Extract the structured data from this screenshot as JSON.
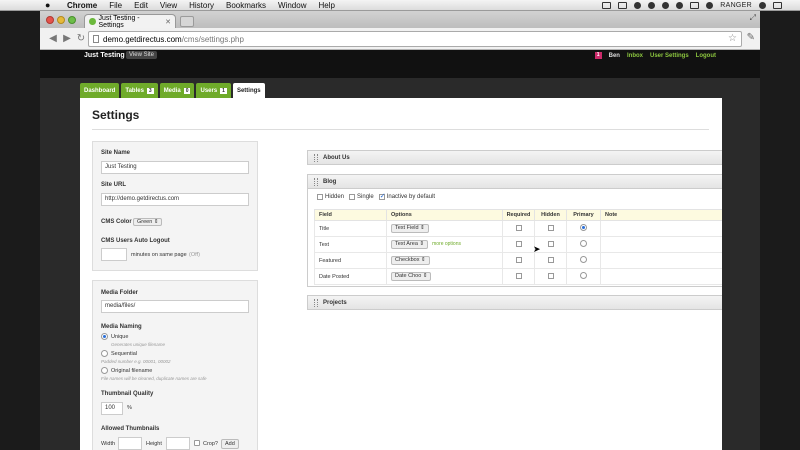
{
  "menubar": {
    "apple": "",
    "items": [
      "Chrome",
      "File",
      "Edit",
      "View",
      "History",
      "Bookmarks",
      "Window",
      "Help"
    ],
    "user": "RANGER"
  },
  "browser": {
    "tab_title": "Just Testing - Settings",
    "url_host": "demo.getdirectus.com",
    "url_path": "/cms/settings.php"
  },
  "header": {
    "site_title": "Just Testing",
    "view_site": "View Site",
    "badge": "1",
    "user_name": "Ben",
    "links": [
      "Inbox",
      "User Settings",
      "Logout"
    ]
  },
  "nav": {
    "dashboard": "Dashboard",
    "tables": "Tables",
    "tables_count": "3",
    "media": "Media",
    "media_count": "0",
    "users": "Users",
    "users_count": "1",
    "settings": "Settings"
  },
  "page": {
    "title": "Settings"
  },
  "general": {
    "site_name_label": "Site Name",
    "site_name_value": "Just Testing",
    "site_url_label": "Site URL",
    "site_url_value": "http://demo.getdirectus.com",
    "cms_color_label": "CMS Color",
    "cms_color_value": "Green",
    "logout_label": "CMS Users Auto Logout",
    "logout_suffix": "minutes on same page",
    "logout_off": "(Off)"
  },
  "media": {
    "folder_label": "Media Folder",
    "folder_value": "media/files/",
    "naming_label": "Media Naming",
    "opt_unique": "Unique",
    "opt_unique_hint": "Generates unique filename",
    "opt_sequential": "Sequential",
    "opt_sequential_hint": "Padded number e.g. 00001, 00002",
    "opt_original": "Original filename",
    "opt_original_hint": "File names will be cleaned, duplicate names are safe",
    "thumb_quality_label": "Thumbnail Quality",
    "thumb_quality_value": "100",
    "thumb_quality_unit": "%",
    "allowed_thumbs_label": "Allowed Thumbnails",
    "width_label": "Width",
    "height_label": "Height",
    "crop_label": "Crop?",
    "add_button": "Add"
  },
  "sections": {
    "about": "About Us",
    "blog": "Blog",
    "projects": "Projects",
    "blog_opts": {
      "hidden": "Hidden",
      "single": "Single",
      "inactive": "Inactive by default"
    },
    "columns": [
      "Field",
      "Options",
      "Required",
      "Hidden",
      "Primary",
      "Note"
    ],
    "rows": [
      {
        "field": "Title",
        "option": "Text Field",
        "more": ""
      },
      {
        "field": "Text",
        "option": "Text Area",
        "more": "more options"
      },
      {
        "field": "Featured",
        "option": "Checkbox",
        "more": ""
      },
      {
        "field": "Date Posted",
        "option": "Date Choo",
        "more": ""
      }
    ]
  }
}
